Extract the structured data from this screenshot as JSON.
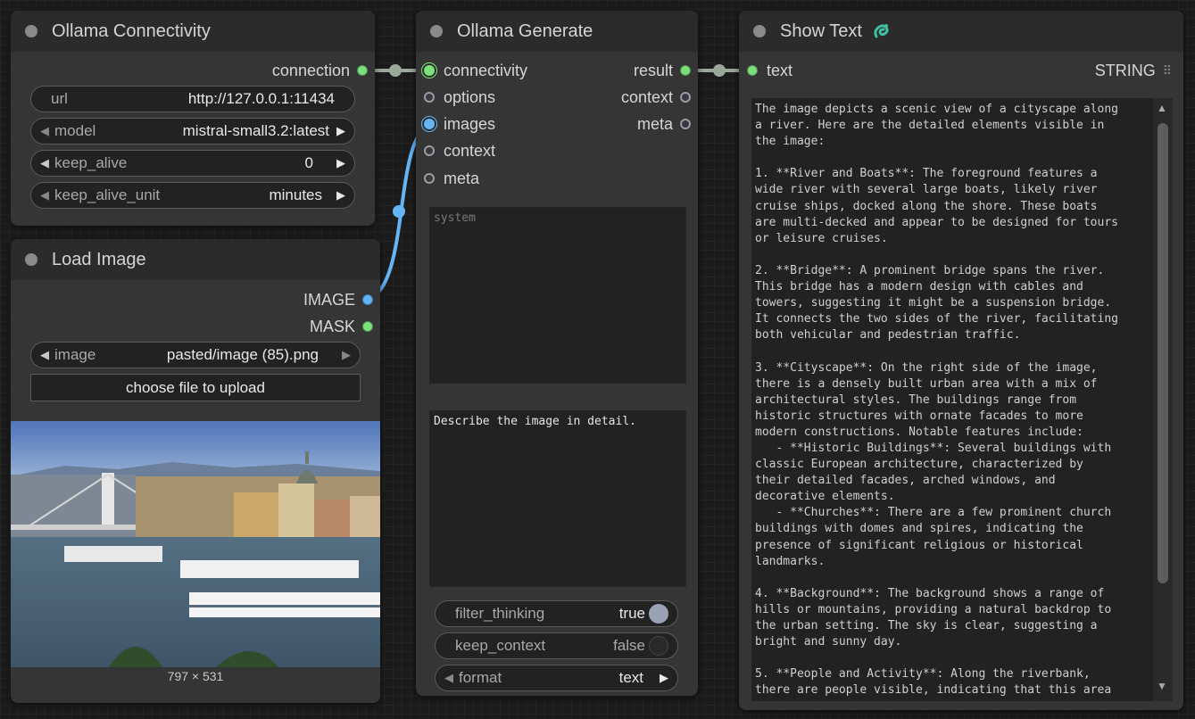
{
  "nodes": {
    "connectivity": {
      "title": "Ollama Connectivity",
      "output": "connection",
      "url_label": "url",
      "url_value": "http://127.0.0.1:11434",
      "model_label": "model",
      "model_value": "mistral-small3.2:latest",
      "keep_alive_label": "keep_alive",
      "keep_alive_value": "0",
      "keep_alive_unit_label": "keep_alive_unit",
      "keep_alive_unit_value": "minutes"
    },
    "load_image": {
      "title": "Load Image",
      "output_image": "IMAGE",
      "output_mask": "MASK",
      "image_label": "image",
      "image_value": "pasted/image (85).png",
      "upload_button": "choose file to upload",
      "dimensions": "797 × 531"
    },
    "generate": {
      "title": "Ollama Generate",
      "inputs": [
        "connectivity",
        "options",
        "images",
        "context",
        "meta"
      ],
      "outputs": [
        "result",
        "context",
        "meta"
      ],
      "system_placeholder": "system",
      "prompt_value": "Describe the image in detail.",
      "filter_thinking_label": "filter_thinking",
      "filter_thinking_value": "true",
      "keep_context_label": "keep_context",
      "keep_context_value": "false",
      "format_label": "format",
      "format_value": "text"
    },
    "show_text": {
      "title": "Show Text",
      "input": "text",
      "output_type": "STRING",
      "content": "The image depicts a scenic view of a cityscape along\na river. Here are the detailed elements visible in\nthe image:\n\n1. **River and Boats**: The foreground features a\nwide river with several large boats, likely river\ncruise ships, docked along the shore. These boats\nare multi-decked and appear to be designed for tours\nor leisure cruises.\n\n2. **Bridge**: A prominent bridge spans the river.\nThis bridge has a modern design with cables and\ntowers, suggesting it might be a suspension bridge.\nIt connects the two sides of the river, facilitating\nboth vehicular and pedestrian traffic.\n\n3. **Cityscape**: On the right side of the image,\nthere is a densely built urban area with a mix of\narchitectural styles. The buildings range from\nhistoric structures with ornate facades to more\nmodern constructions. Notable features include:\n   - **Historic Buildings**: Several buildings with\nclassic European architecture, characterized by\ntheir detailed facades, arched windows, and\ndecorative elements.\n   - **Churches**: There are a few prominent church\nbuildings with domes and spires, indicating the\npresence of significant religious or historical\nlandmarks.\n\n4. **Background**: The background shows a range of\nhills or mountains, providing a natural backdrop to\nthe urban setting. The sky is clear, suggesting a\nbright and sunny day.\n\n5. **People and Activity**: Along the riverbank,\nthere are people visible, indicating that this area"
    }
  },
  "colors": {
    "link_green": "#9aa89a",
    "link_blue": "#64b5f6",
    "pin_green": "#7be07b",
    "pin_blue": "#64b5f6"
  }
}
